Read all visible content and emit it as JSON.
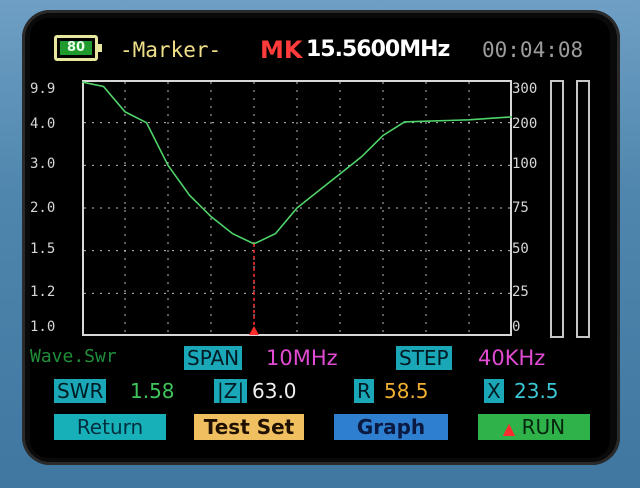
{
  "header": {
    "battery_level": "80",
    "mode_label": "-Marker-",
    "mk_label": "MK",
    "frequency": "15.5600MHz",
    "clock": "00:04:08"
  },
  "graph": {
    "left_axis": [
      "9.9",
      "4.0",
      "3.0",
      "2.0",
      "1.5",
      "1.2",
      "1.0"
    ],
    "right_axis": [
      "300",
      "200",
      "100",
      "75",
      "50",
      "25",
      "0"
    ],
    "wave_label": "Wave.Swr"
  },
  "chart_data": {
    "type": "line",
    "series": [
      {
        "x_points": [
          0,
          5,
          10,
          15,
          20,
          25,
          30,
          35,
          40,
          45,
          50,
          55,
          60,
          65,
          70,
          75,
          80,
          85,
          90,
          95,
          100
        ],
        "swr_values": [
          9.9,
          9.0,
          5.5,
          4.0,
          3.0,
          2.3,
          1.9,
          1.7,
          1.58,
          1.7,
          2.0,
          2.4,
          2.8,
          3.2,
          3.7,
          4.1,
          4.2,
          4.3,
          4.4,
          4.6,
          4.8
        ]
      }
    ],
    "marker_x": 40,
    "colors": {
      "trace": "#4fd36a",
      "marker": "#ff2d2d",
      "grid": "#d0d0d0"
    }
  },
  "params": {
    "span_label": "SPAN",
    "span_value": "10MHz",
    "step_label": "STEP",
    "step_value": "40KHz",
    "swr_label": "SWR",
    "swr_value": "1.58",
    "z_label": "|Z|",
    "z_value": "63.0",
    "r_label": "R",
    "r_value": "58.5",
    "x_label": "X",
    "x_value": "23.5"
  },
  "buttons": {
    "return": "Return",
    "test_set": "Test Set",
    "graph": "Graph",
    "run": "RUN"
  }
}
